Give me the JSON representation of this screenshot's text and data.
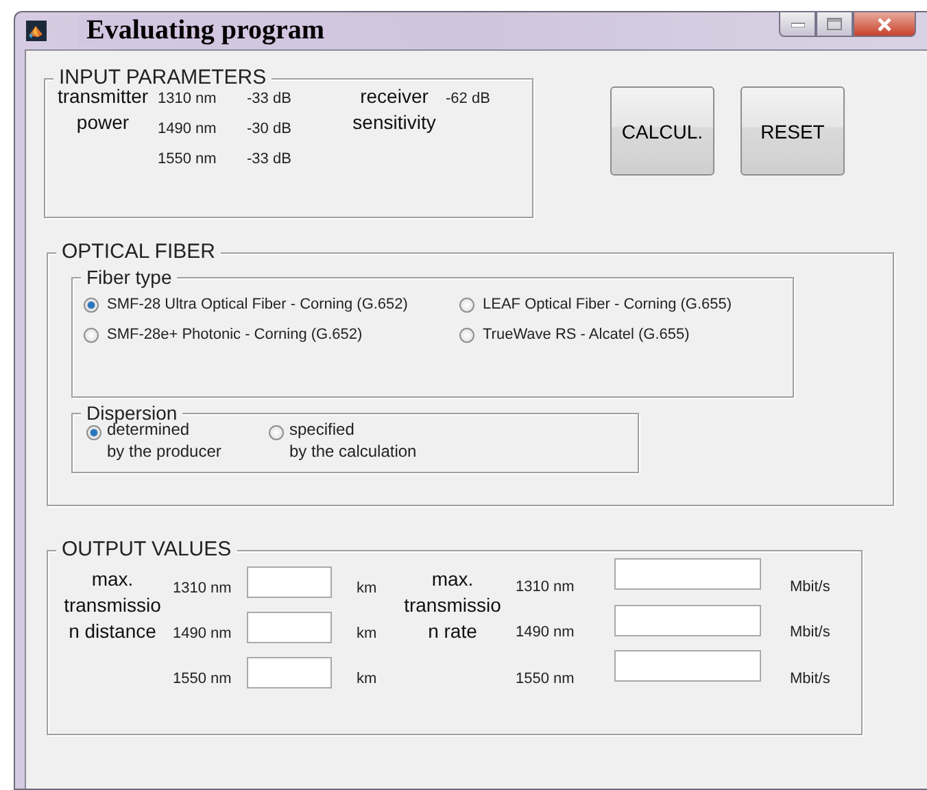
{
  "window": {
    "title": "Evaluating program"
  },
  "input_parameters": {
    "title": "INPUT PARAMETERS",
    "transmitter_label": [
      "transmitter",
      "power"
    ],
    "transmitter_rows": [
      {
        "wavelength": "1310 nm",
        "value": "-33 dB"
      },
      {
        "wavelength": "1490 nm",
        "value": "-30 dB"
      },
      {
        "wavelength": "1550 nm",
        "value": "-33 dB"
      }
    ],
    "receiver_label": [
      "receiver",
      "sensitivity"
    ],
    "receiver_value": "-62 dB"
  },
  "buttons": [
    "CALCUL.",
    "RESET"
  ],
  "optical_fiber": {
    "title": "OPTICAL FIBER",
    "fiber_type": {
      "title": "Fiber type",
      "options": [
        {
          "label": "SMF-28 Ultra Optical Fiber - Corning (G.652)",
          "selected": true
        },
        {
          "label": "LEAF Optical Fiber - Corning (G.655)",
          "selected": false
        },
        {
          "label": "SMF-28e+ Photonic - Corning (G.652)",
          "selected": false
        },
        {
          "label": "TrueWave RS - Alcatel (G.655)",
          "selected": false
        }
      ]
    },
    "dispersion": {
      "title": "Dispersion",
      "options": [
        {
          "lines": [
            "determined",
            "by the producer"
          ],
          "selected": true
        },
        {
          "lines": [
            "specified",
            "by the calculation"
          ],
          "selected": false
        }
      ]
    }
  },
  "output_values": {
    "title": "OUTPUT VALUES",
    "groups": [
      {
        "label": [
          "max.",
          "transmissio",
          "n distance"
        ],
        "rows": [
          {
            "wavelength": "1310 nm",
            "unit": "km"
          },
          {
            "wavelength": "1490 nm",
            "unit": "km"
          },
          {
            "wavelength": "1550 nm",
            "unit": "km"
          }
        ]
      },
      {
        "label": [
          "max.",
          "transmissio",
          "n rate"
        ],
        "rows": [
          {
            "wavelength": "1310 nm",
            "unit": "Mbit/s"
          },
          {
            "wavelength": "1490 nm",
            "unit": "Mbit/s"
          },
          {
            "wavelength": "1550 nm",
            "unit": "Mbit/s"
          }
        ]
      }
    ]
  }
}
